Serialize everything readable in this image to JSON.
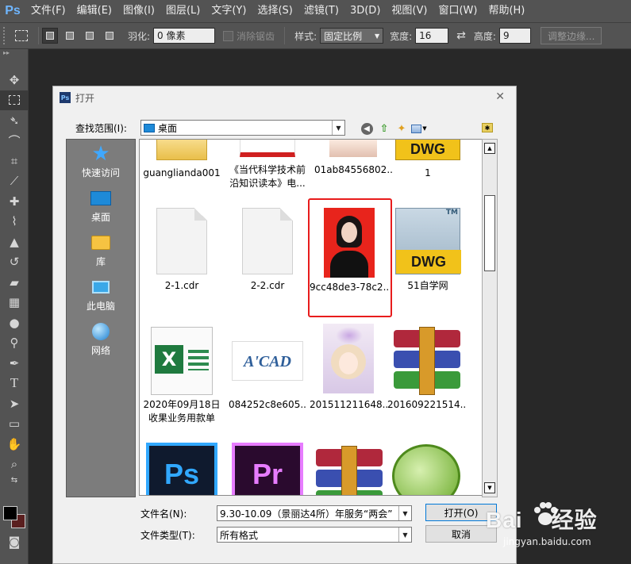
{
  "app": {
    "logo": "Ps",
    "menu": [
      "文件(F)",
      "编辑(E)",
      "图像(I)",
      "图层(L)",
      "文字(Y)",
      "选择(S)",
      "滤镜(T)",
      "3D(D)",
      "视图(V)",
      "窗口(W)",
      "帮助(H)"
    ]
  },
  "options": {
    "feather_label": "羽化:",
    "feather_value": "0 像素",
    "antialias_label": "消除锯齿",
    "style_label": "样式:",
    "style_value": "固定比例",
    "width_label": "宽度:",
    "width_value": "16",
    "height_label": "高度:",
    "height_value": "9",
    "refine_button": "调整边缘..."
  },
  "dialog": {
    "title": "打开",
    "lookin_label": "查找范围(I):",
    "lookin_value": "桌面",
    "places": [
      {
        "label": "快速访问",
        "icon": "star-icon"
      },
      {
        "label": "桌面",
        "icon": "desktop-icon"
      },
      {
        "label": "库",
        "icon": "library-icon"
      },
      {
        "label": "此电脑",
        "icon": "computer-icon"
      },
      {
        "label": "网络",
        "icon": "network-icon"
      }
    ],
    "files": [
      {
        "label": "guanglianda001"
      },
      {
        "label": "《当代科学技术前",
        "label2": "沿知识读本》电..."
      },
      {
        "label": "01ab84556802..."
      },
      {
        "label": "1"
      },
      {
        "label": "2-1.cdr"
      },
      {
        "label": "2-2.cdr"
      },
      {
        "label": "9cc48de3-78c2..."
      },
      {
        "label": "51自学网"
      },
      {
        "label": "2020年09月18日",
        "label2": "收果业务用款单"
      },
      {
        "label": "084252c8e605..."
      },
      {
        "label": "201511211648..."
      },
      {
        "label": "201609221514..."
      }
    ],
    "thumb_text": {
      "dwg": "DWG",
      "tm": "TM",
      "acad": "A'CAD",
      "excel": "X",
      "ps": "Ps",
      "pr": "Pr"
    },
    "filename_label": "文件名(N):",
    "filename_value": "9.30-10.09（景丽达4所）年服务“两会”",
    "filetype_label": "文件类型(T):",
    "filetype_value": "所有格式",
    "open_button": "打开(O)",
    "cancel_button": "取消"
  },
  "watermark": {
    "text_left": "Bai",
    "text_right": "经验",
    "url": "jingyan.baidu.com"
  },
  "colors": {
    "selection_border": "#e81c1c",
    "accent_blue": "#31a8ff"
  }
}
